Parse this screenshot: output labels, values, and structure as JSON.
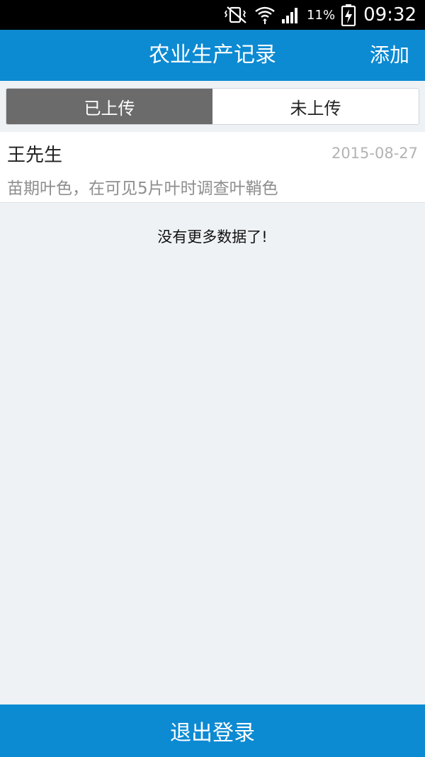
{
  "status_bar": {
    "battery_percent": "11%",
    "time": "09:32",
    "icons": [
      "vibrate-mute-icon",
      "wifi-icon",
      "signal-icon",
      "battery-charging-icon"
    ]
  },
  "header": {
    "title": "农业生产记录",
    "add_label": "添加"
  },
  "tabs": [
    {
      "label": "已上传",
      "active": true
    },
    {
      "label": "未上传",
      "active": false
    }
  ],
  "records": [
    {
      "name": "王先生",
      "date": "2015-08-27",
      "description": "苗期叶色，在可见5片叶时调查叶鞘色"
    }
  ],
  "empty_message": "没有更多数据了!",
  "footer": {
    "logout_label": "退出登录"
  },
  "colors": {
    "primary": "#0c8ad2",
    "active_tab": "#6b6b6b",
    "background": "#eff2f5"
  }
}
